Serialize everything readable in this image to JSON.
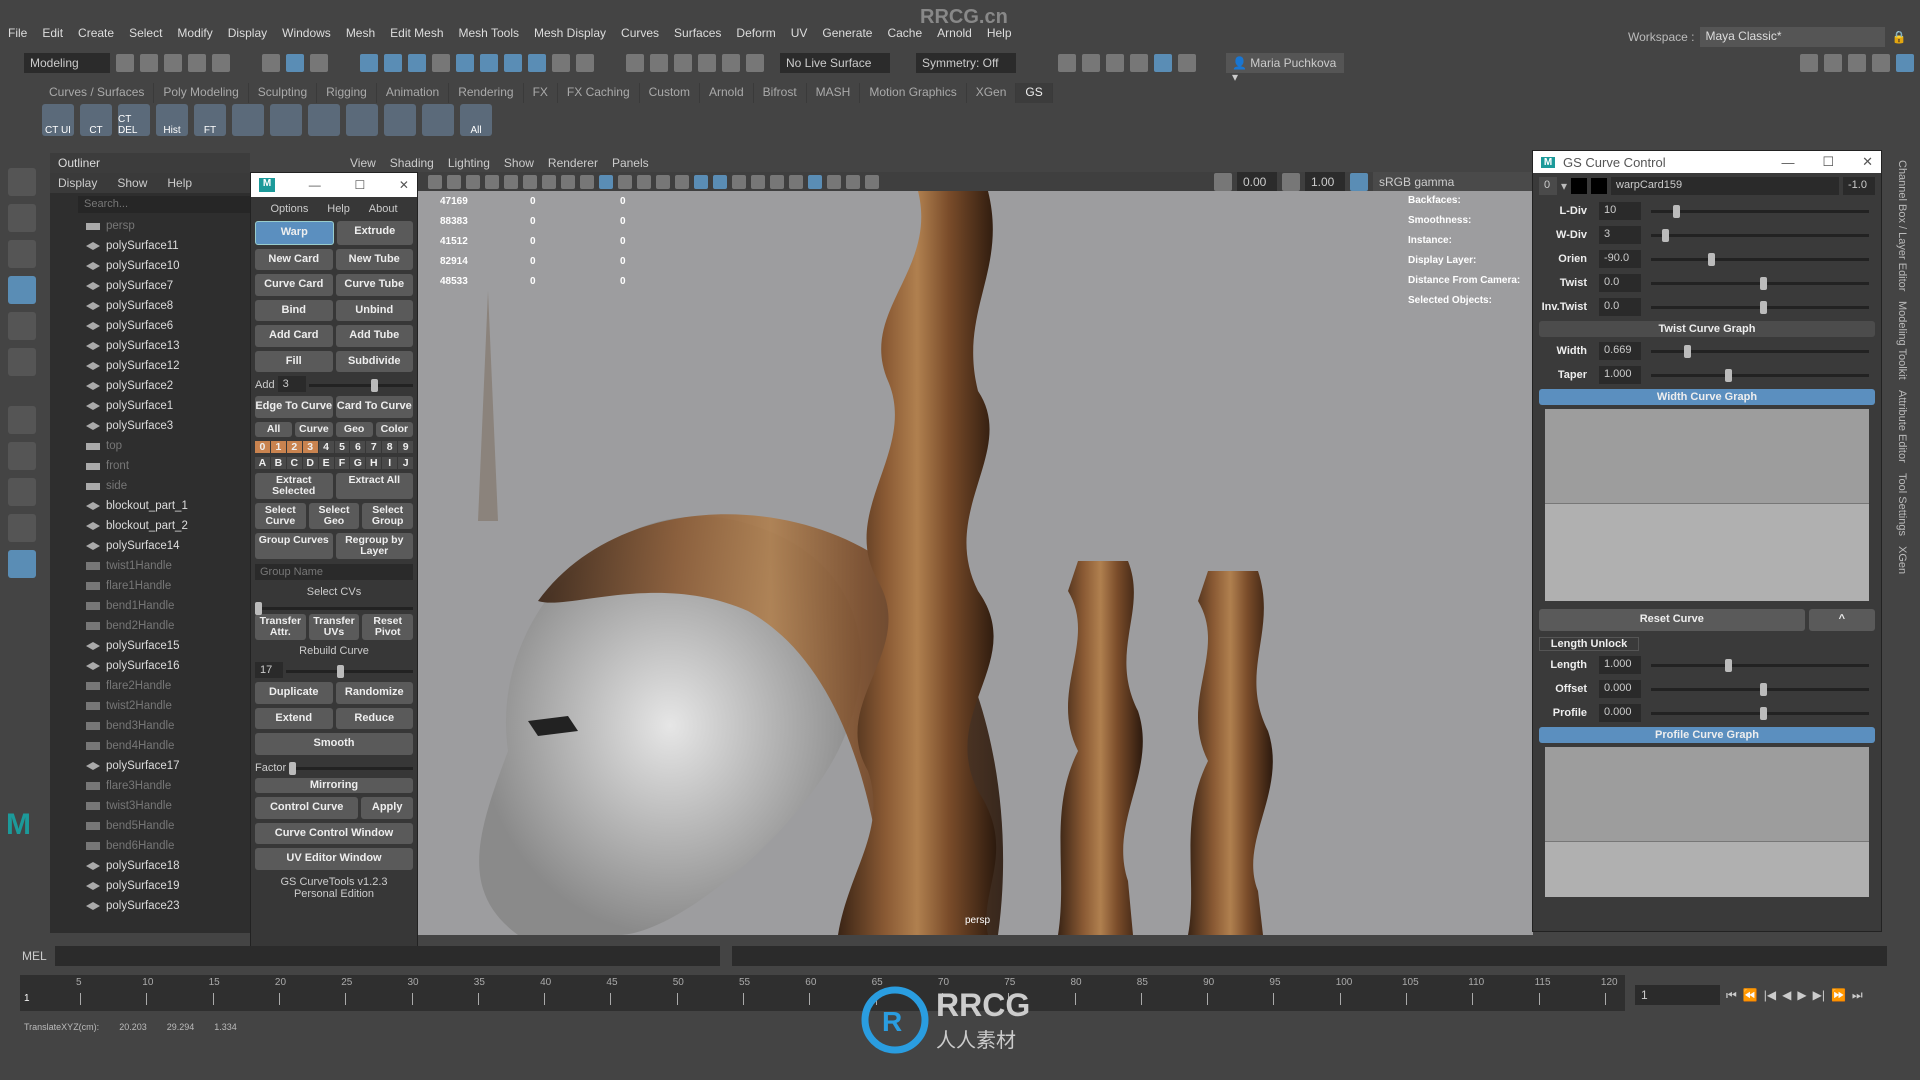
{
  "watermark": "RRCG.cn",
  "menubar": [
    "File",
    "Edit",
    "Create",
    "Select",
    "Modify",
    "Display",
    "Windows",
    "Mesh",
    "Edit Mesh",
    "Mesh Tools",
    "Mesh Display",
    "Curves",
    "Surfaces",
    "Deform",
    "UV",
    "Generate",
    "Cache",
    "Arnold",
    "Help"
  ],
  "workspace": {
    "label": "Workspace :",
    "value": "Maya Classic*"
  },
  "toolbar": {
    "mode": "Modeling",
    "live_surface": "No Live Surface",
    "symmetry": "Symmetry: Off",
    "user": "Maria Puchkova"
  },
  "shelf_tabs": [
    "Curves / Surfaces",
    "Poly Modeling",
    "Sculpting",
    "Rigging",
    "Animation",
    "Rendering",
    "FX",
    "FX Caching",
    "Custom",
    "Arnold",
    "Bifrost",
    "MASH",
    "Motion Graphics",
    "XGen",
    "GS"
  ],
  "shelf_active": "GS",
  "shelf_icons": [
    "CT UI",
    "CT",
    "CT DEL",
    "Hist",
    "FT",
    "",
    "",
    "",
    "",
    "",
    "",
    "All"
  ],
  "outliner": {
    "title": "Outliner",
    "menu": [
      "Display",
      "Show",
      "Help"
    ],
    "search_placeholder": "Search...",
    "items": [
      [
        "persp",
        "cam"
      ],
      [
        "polySurface11",
        "mesh"
      ],
      [
        "polySurface10",
        "mesh"
      ],
      [
        "polySurface7",
        "mesh"
      ],
      [
        "polySurface8",
        "mesh"
      ],
      [
        "polySurface6",
        "mesh"
      ],
      [
        "polySurface13",
        "mesh"
      ],
      [
        "polySurface12",
        "mesh"
      ],
      [
        "polySurface2",
        "mesh"
      ],
      [
        "polySurface1",
        "mesh"
      ],
      [
        "polySurface3",
        "mesh"
      ],
      [
        "top",
        "cam"
      ],
      [
        "front",
        "cam"
      ],
      [
        "side",
        "cam"
      ],
      [
        "blockout_part_1",
        "mesh"
      ],
      [
        "blockout_part_2",
        "mesh"
      ],
      [
        "polySurface14",
        "mesh"
      ],
      [
        "twist1Handle",
        "hnd"
      ],
      [
        "flare1Handle",
        "hnd"
      ],
      [
        "bend1Handle",
        "hnd"
      ],
      [
        "bend2Handle",
        "hnd"
      ],
      [
        "polySurface15",
        "mesh"
      ],
      [
        "polySurface16",
        "mesh"
      ],
      [
        "flare2Handle",
        "hnd"
      ],
      [
        "twist2Handle",
        "hnd"
      ],
      [
        "bend3Handle",
        "hnd"
      ],
      [
        "bend4Handle",
        "hnd"
      ],
      [
        "polySurface17",
        "mesh"
      ],
      [
        "flare3Handle",
        "hnd"
      ],
      [
        "twist3Handle",
        "hnd"
      ],
      [
        "bend5Handle",
        "hnd"
      ],
      [
        "bend6Handle",
        "hnd"
      ],
      [
        "polySurface18",
        "mesh"
      ],
      [
        "polySurface19",
        "mesh"
      ],
      [
        "polySurface23",
        "mesh"
      ]
    ]
  },
  "gs": {
    "menu": [
      "Options",
      "Help",
      "About"
    ],
    "rows1": [
      [
        "Warp",
        "Extrude"
      ],
      [
        "New Card",
        "New Tube"
      ],
      [
        "Curve Card",
        "Curve Tube"
      ],
      [
        "Bind",
        "Unbind"
      ],
      [
        "Add Card",
        "Add Tube"
      ],
      [
        "Fill",
        "Subdivide"
      ]
    ],
    "add_label": "Add",
    "add_value": "3",
    "rows2": [
      [
        "Edge To Curve",
        "Card To Curve"
      ]
    ],
    "filter": [
      "All",
      "Curve",
      "Geo",
      "Color"
    ],
    "numbers": [
      "0",
      "1",
      "2",
      "3",
      "4",
      "5",
      "6",
      "7",
      "8",
      "9"
    ],
    "letters": [
      "A",
      "B",
      "C",
      "D",
      "E",
      "F",
      "G",
      "H",
      "I",
      "J"
    ],
    "extract": [
      "Extract Selected",
      "Extract All"
    ],
    "select": [
      "Select Curve",
      "Select Geo",
      "Select Group"
    ],
    "group": [
      "Group Curves",
      "Regroup by Layer"
    ],
    "group_placeholder": "Group Name",
    "select_cvs": "Select CVs",
    "transfer": [
      "Transfer Attr.",
      "Transfer UVs",
      "Reset Pivot"
    ],
    "rebuild": "Rebuild Curve",
    "rebuild_value": "17",
    "rows3": [
      [
        "Duplicate",
        "Randomize"
      ],
      [
        "Extend",
        "Reduce"
      ]
    ],
    "smooth": "Smooth",
    "factor": "Factor",
    "mirroring": "Mirroring",
    "control_curve": "Control Curve",
    "apply": "Apply",
    "ccw": "Curve Control Window",
    "uvw": "UV Editor Window",
    "version": "GS CurveTools v1.2.3",
    "edition": "Personal Edition"
  },
  "viewport": {
    "menu": [
      "View",
      "Shading",
      "Lighting",
      "Show",
      "Renderer",
      "Panels"
    ],
    "exposure": "0.00",
    "gamma": "1.00",
    "colorspace": "sRGB gamma",
    "stats": [
      [
        "47169",
        "0",
        "0"
      ],
      [
        "88383",
        "0",
        "0"
      ],
      [
        "41512",
        "0",
        "0"
      ],
      [
        "82914",
        "0",
        "0"
      ],
      [
        "48533",
        "0",
        "0"
      ]
    ],
    "hud": [
      "Backfaces:",
      "Smoothness:",
      "Instance:",
      "Display Layer:",
      "Distance From Camera:",
      "Selected Objects:"
    ],
    "camera": "persp"
  },
  "gcc": {
    "title": "GS Curve Control",
    "layer": "0",
    "name": "warpCard159",
    "value": "-1.0",
    "params": [
      {
        "label": "L-Div",
        "value": "10",
        "pos": 0.1
      },
      {
        "label": "W-Div",
        "value": "3",
        "pos": 0.05
      },
      {
        "label": "Orien",
        "value": "-90.0",
        "pos": 0.26
      },
      {
        "label": "Twist",
        "value": "0.0",
        "pos": 0.5
      },
      {
        "label": "Inv.Twist",
        "value": "0.0",
        "pos": 0.5
      }
    ],
    "twist_graph": "Twist Curve Graph",
    "params2": [
      {
        "label": "Width",
        "value": "0.669",
        "pos": 0.15
      },
      {
        "label": "Taper",
        "value": "1.000",
        "pos": 0.34
      }
    ],
    "width_graph": "Width Curve Graph",
    "reset": "Reset Curve",
    "caret": "^",
    "length_unlock": "Length Unlock",
    "params3": [
      {
        "label": "Length",
        "value": "1.000",
        "pos": 0.34
      },
      {
        "label": "Offset",
        "value": "0.000",
        "pos": 0.5
      },
      {
        "label": "Profile",
        "value": "0.000",
        "pos": 0.5
      }
    ],
    "profile_graph": "Profile Curve Graph"
  },
  "right_tabs": [
    "Channel Box / Layer Editor",
    "Modeling Toolkit",
    "Attribute Editor",
    "Tool Settings",
    "XGen"
  ],
  "mel": "MEL",
  "timeline": {
    "ticks": [
      "5",
      "10",
      "15",
      "20",
      "25",
      "30",
      "35",
      "40",
      "45",
      "50",
      "55",
      "60",
      "65",
      "70",
      "75",
      "80",
      "85",
      "90",
      "95",
      "100",
      "105",
      "110",
      "115",
      "120"
    ],
    "start": "1",
    "current": "1"
  },
  "status": {
    "label": "TranslateXYZ(cm):",
    "x": "20.203",
    "y": "29.294",
    "z": "1.334"
  },
  "logo": {
    "text": "RRCG",
    "sub": "人人素材"
  }
}
